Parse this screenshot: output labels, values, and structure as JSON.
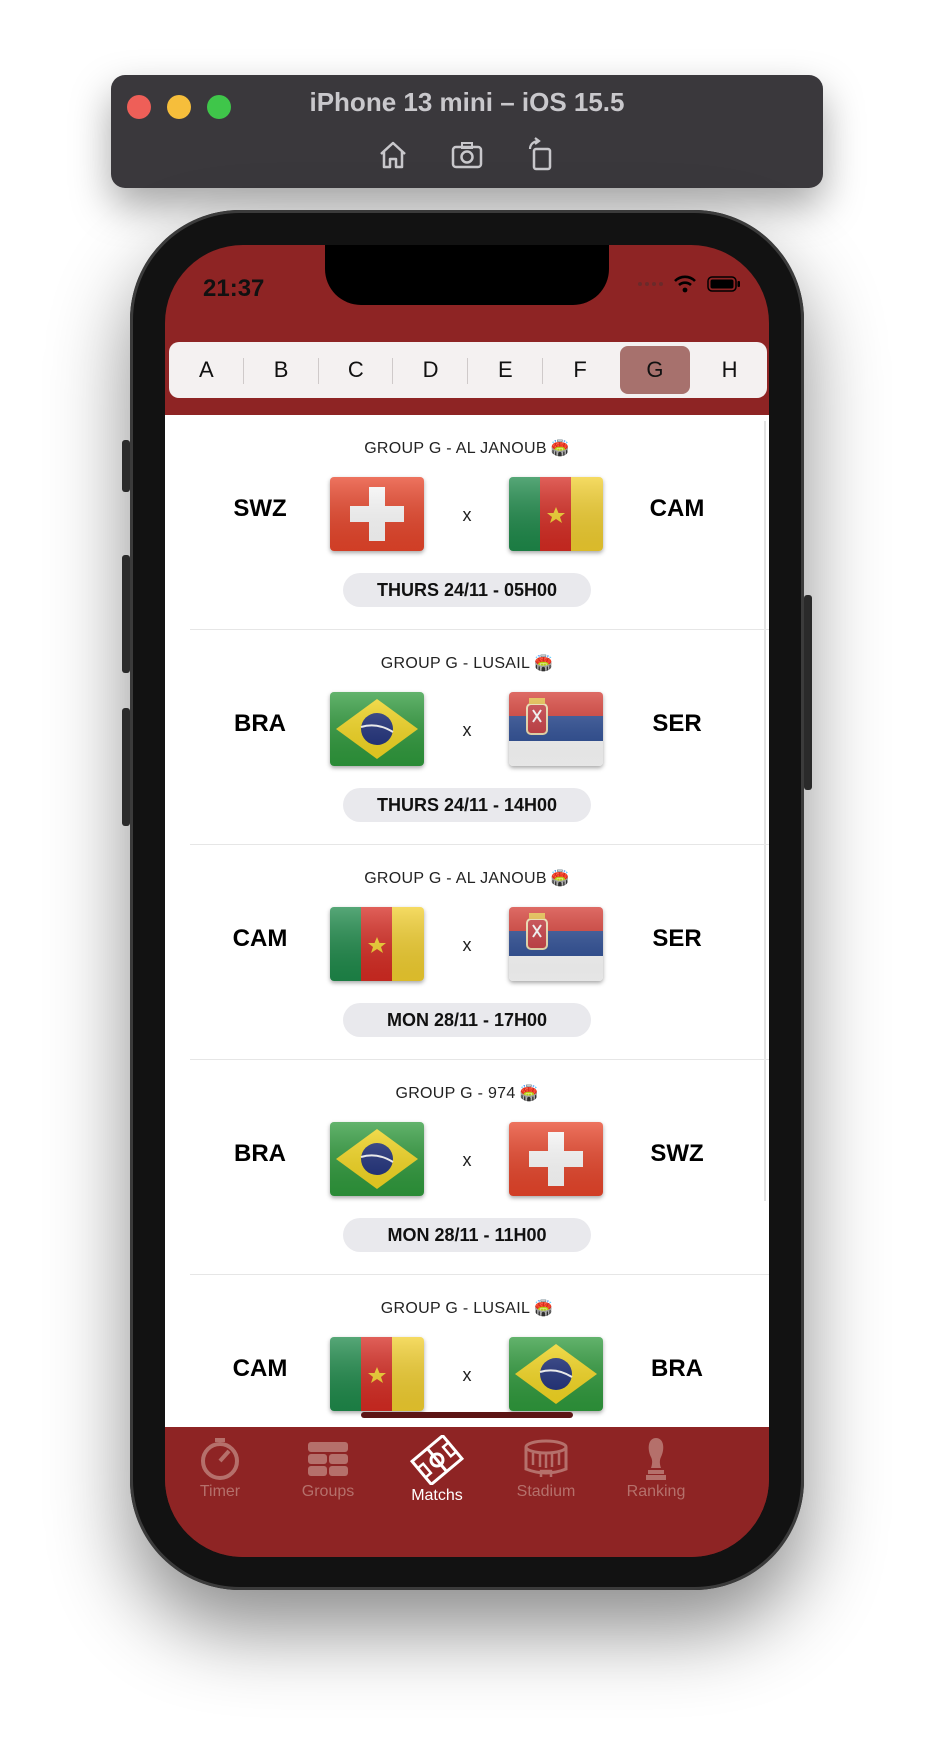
{
  "simulator": {
    "title": "iPhone 13 mini – iOS 15.5",
    "tools": [
      "home-icon",
      "screenshot-icon",
      "rotate-icon"
    ]
  },
  "status": {
    "time": "21:37"
  },
  "groups": {
    "letters": [
      "A",
      "B",
      "C",
      "D",
      "E",
      "F",
      "G",
      "H"
    ],
    "selected": "G"
  },
  "matches": [
    {
      "venue": "GROUP G - AL JANOUB",
      "home": "SWZ",
      "away": "CAM",
      "home_flag": "switzerland",
      "away_flag": "cameroon",
      "separator": "x",
      "date": "THURS 24/11 - 05H00"
    },
    {
      "venue": "GROUP G - LUSAIL",
      "home": "BRA",
      "away": "SER",
      "home_flag": "brazil",
      "away_flag": "serbia",
      "separator": "x",
      "date": "THURS 24/11 - 14H00"
    },
    {
      "venue": "GROUP G - AL JANOUB",
      "home": "CAM",
      "away": "SER",
      "home_flag": "cameroon",
      "away_flag": "serbia",
      "separator": "x",
      "date": "MON 28/11 - 17H00"
    },
    {
      "venue": "GROUP G - 974",
      "home": "BRA",
      "away": "SWZ",
      "home_flag": "brazil",
      "away_flag": "switzerland",
      "separator": "x",
      "date": "MON 28/11 - 11H00"
    },
    {
      "venue": "GROUP G - LUSAIL",
      "home": "CAM",
      "away": "BRA",
      "home_flag": "cameroon",
      "away_flag": "brazil",
      "separator": "x",
      "date": ""
    }
  ],
  "tabs": [
    {
      "label": "Timer",
      "icon": "timer-icon"
    },
    {
      "label": "Groups",
      "icon": "groups-icon"
    },
    {
      "label": "Matchs",
      "icon": "pitch-icon",
      "active": true
    },
    {
      "label": "Stadium",
      "icon": "stadium-icon"
    },
    {
      "label": "Ranking",
      "icon": "trophy-icon"
    }
  ],
  "colors": {
    "brand": "#8e2424",
    "selected_segment": "#a7716d",
    "inactive_tab": "#b5706b"
  }
}
